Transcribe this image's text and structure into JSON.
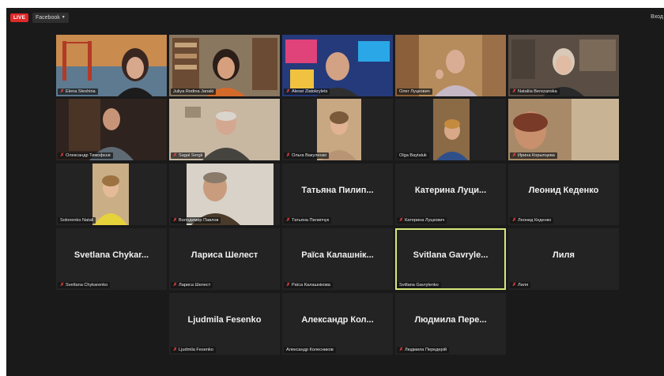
{
  "topbar": {
    "live_label": "LIVE",
    "facebook_label": "Facebook",
    "facebook_caret": "▼",
    "signin_label": "Вход"
  },
  "colors": {
    "live": "#e02828",
    "active_speaker": "#d6e87a",
    "muted_mic": "#f04848",
    "background": "#1a1a1a"
  },
  "participants": [
    {
      "caption": "Elena Steshina",
      "display": "",
      "video": true,
      "muted": true
    },
    {
      "caption": "Juliya Rodina Janaki",
      "display": "",
      "video": true,
      "muted": false
    },
    {
      "caption": "Alexei Zlatokrylets",
      "display": "",
      "video": true,
      "muted": true
    },
    {
      "caption": "Олег Луцкович",
      "display": "",
      "video": true,
      "muted": false
    },
    {
      "caption": "Nataliia Berezanska",
      "display": "",
      "video": true,
      "muted": true
    },
    {
      "caption": "Олександр Тимофєєв",
      "display": "",
      "video": true,
      "muted": true
    },
    {
      "caption": "Sagal Sergii",
      "display": "",
      "video": true,
      "muted": true
    },
    {
      "caption": "Ольга Вакуленко",
      "display": "",
      "video": true,
      "muted": true
    },
    {
      "caption": "Olga Baytaluk",
      "display": "",
      "video": true,
      "muted": false
    },
    {
      "caption": "Ирина Корыпцева",
      "display": "",
      "video": true,
      "muted": true
    },
    {
      "caption": "Solonenko Natali",
      "display": "",
      "video": true,
      "muted": false
    },
    {
      "caption": "Володимир Павлов",
      "display": "",
      "video": true,
      "muted": true
    },
    {
      "caption": "Татьяна Пилипчук",
      "display": "Татьяна Пилип...",
      "video": false,
      "muted": true
    },
    {
      "caption": "Катерина Луцкович",
      "display": "Катерина Луци...",
      "video": false,
      "muted": true
    },
    {
      "caption": "Леонид Кеденко",
      "display": "Леонид Кеденко",
      "video": false,
      "muted": true
    },
    {
      "caption": "Svetlana Chykarenko",
      "display": "Svetlana Chykar...",
      "video": false,
      "muted": true
    },
    {
      "caption": "Лариса Шелест",
      "display": "Лариса Шелест",
      "video": false,
      "muted": true
    },
    {
      "caption": "Раїса Калашнікова",
      "display": "Раїса Калашнік...",
      "video": false,
      "muted": true
    },
    {
      "caption": "Svitlana Gavrylenko",
      "display": "Svitlana Gavryle...",
      "video": false,
      "muted": false,
      "active": true
    },
    {
      "caption": "Лиля",
      "display": "Лиля",
      "video": false,
      "muted": true
    },
    {
      "caption": "Ljudmila Fesenko",
      "display": "Ljudmila Fesenko",
      "video": false,
      "muted": true
    },
    {
      "caption": "Александр Колесников",
      "display": "Александр Кол...",
      "video": false,
      "muted": false
    },
    {
      "caption": "Людмила Передерій",
      "display": "Людмила Пере...",
      "video": false,
      "muted": true
    }
  ]
}
